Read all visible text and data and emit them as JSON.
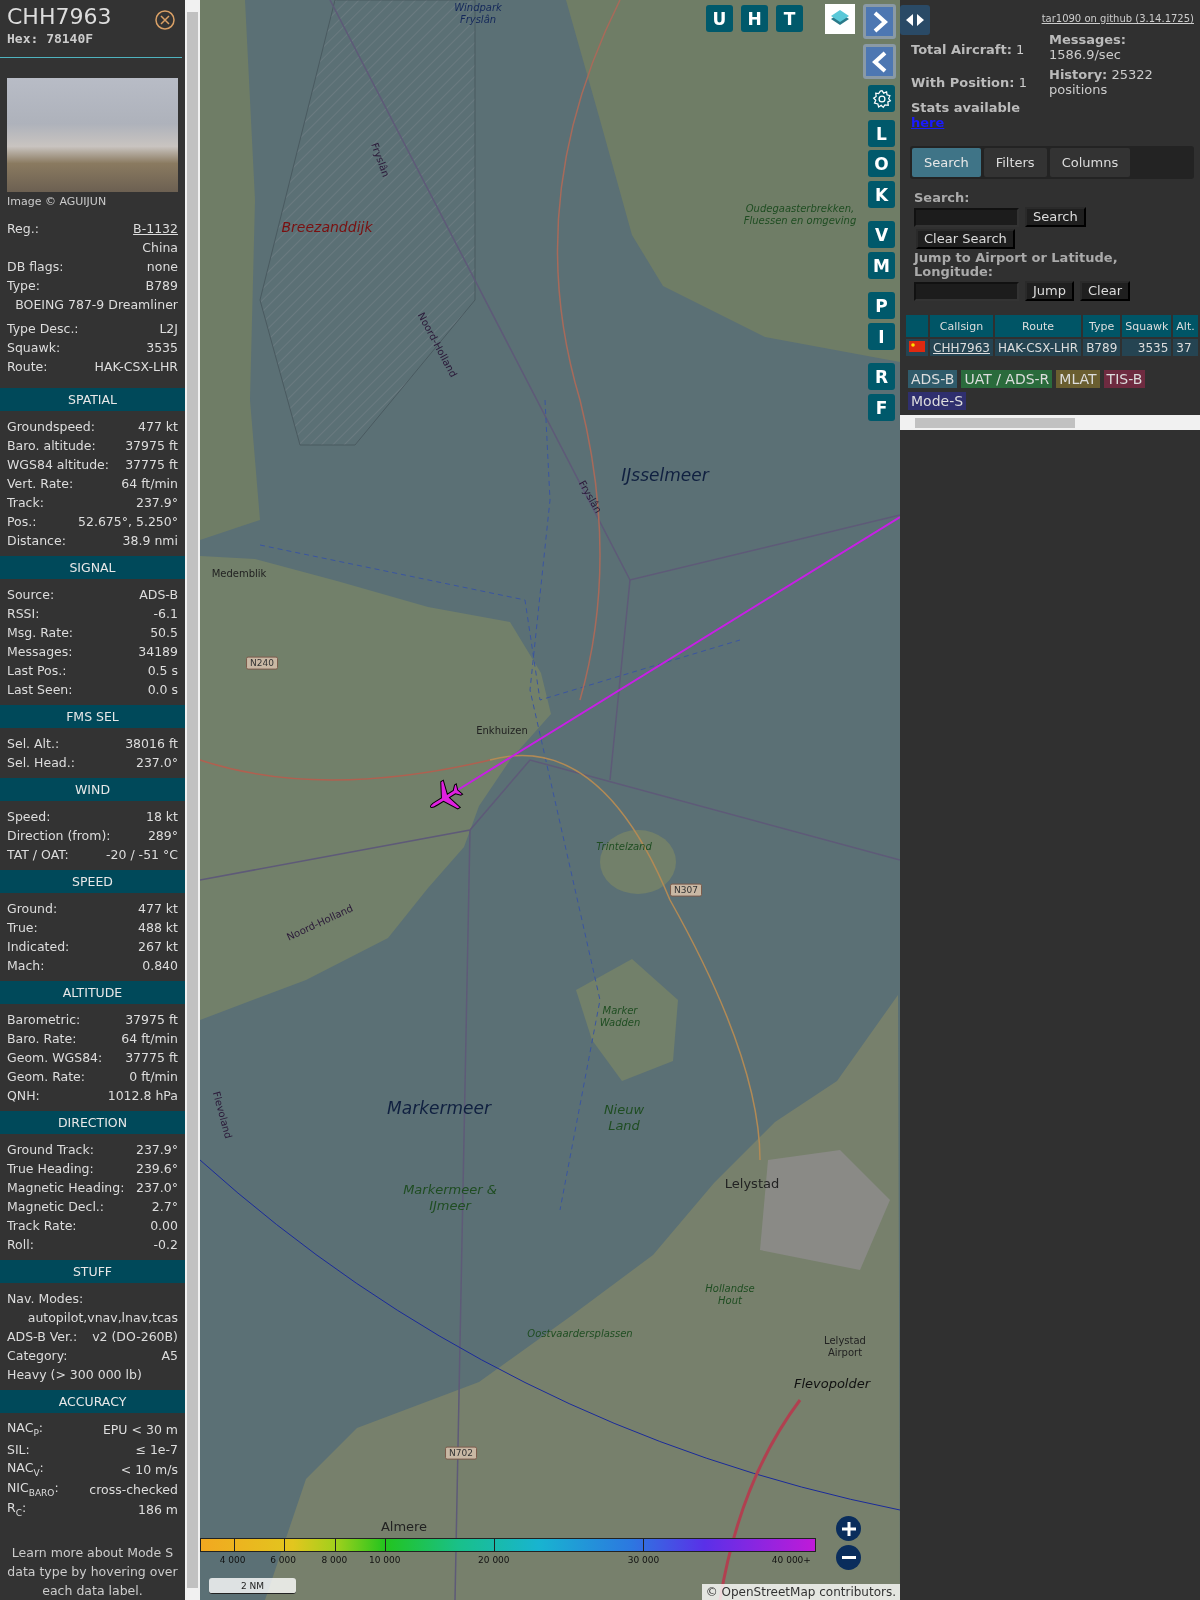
{
  "aircraft": {
    "callsign": "CHH7963",
    "hex": "Hex: 78140F",
    "photo_credit": "Image © AGUIJUN"
  },
  "details": [
    {
      "kind": "link",
      "label": "Reg.:",
      "value": "B-1132"
    },
    {
      "kind": "value",
      "value": "China"
    },
    {
      "kind": "pair",
      "label": "DB flags:",
      "value": "none"
    },
    {
      "kind": "pair",
      "label": "Type:",
      "value": "B789"
    },
    {
      "kind": "value",
      "value": "BOEING 787-9 Dreamliner"
    },
    {
      "kind": "pair",
      "label": "Type Desc.:",
      "value": "L2J"
    },
    {
      "kind": "pair",
      "label": "Squawk:",
      "value": "3535"
    },
    {
      "kind": "pair",
      "label": "Route:",
      "value": "HAK-CSX-LHR"
    }
  ],
  "sections": [
    {
      "title": "SPATIAL",
      "rows": [
        {
          "kind": "pair",
          "label": "Groundspeed:",
          "value": "477 kt"
        },
        {
          "kind": "pair",
          "label": "Baro. altitude:",
          "value": "37975 ft"
        },
        {
          "kind": "pair",
          "label": "WGS84 altitude:",
          "value": "37775 ft"
        },
        {
          "kind": "pair",
          "label": "Vert. Rate:",
          "value": "64 ft/min"
        },
        {
          "kind": "pair",
          "label": "Track:",
          "value": "237.9°"
        },
        {
          "kind": "pair",
          "label": "Pos.:",
          "value": "52.675°, 5.250°"
        },
        {
          "kind": "pair",
          "label": "Distance:",
          "value": "38.9 nmi"
        }
      ]
    },
    {
      "title": "SIGNAL",
      "rows": [
        {
          "kind": "pair",
          "label": "Source:",
          "value": "ADS-B"
        },
        {
          "kind": "pair",
          "label": "RSSI:",
          "value": "-6.1"
        },
        {
          "kind": "pair",
          "label": "Msg. Rate:",
          "value": "50.5"
        },
        {
          "kind": "pair",
          "label": "Messages:",
          "value": "34189"
        },
        {
          "kind": "pair",
          "label": "Last Pos.:",
          "value": "0.5 s"
        },
        {
          "kind": "pair",
          "label": "Last Seen:",
          "value": "0.0 s"
        }
      ]
    },
    {
      "title": "FMS SEL",
      "rows": [
        {
          "kind": "pair",
          "label": "Sel. Alt.:",
          "value": "38016 ft"
        },
        {
          "kind": "pair",
          "label": "Sel. Head.:",
          "value": "237.0°"
        }
      ]
    },
    {
      "title": "WIND",
      "rows": [
        {
          "kind": "pair",
          "label": "Speed:",
          "value": "18 kt"
        },
        {
          "kind": "pair",
          "label": "Direction (from):",
          "value": "289°"
        },
        {
          "kind": "pair",
          "label": "TAT / OAT:",
          "value": "-20 / -51 °C"
        }
      ]
    },
    {
      "title": "SPEED",
      "rows": [
        {
          "kind": "pair",
          "label": "Ground:",
          "value": "477 kt"
        },
        {
          "kind": "pair",
          "label": "True:",
          "value": "488 kt"
        },
        {
          "kind": "pair",
          "label": "Indicated:",
          "value": "267 kt"
        },
        {
          "kind": "pair",
          "label": "Mach:",
          "value": "0.840"
        }
      ]
    },
    {
      "title": "ALTITUDE",
      "rows": [
        {
          "kind": "pair",
          "label": "Barometric:",
          "value": "37975 ft"
        },
        {
          "kind": "pair",
          "label": "Baro. Rate:",
          "value": "64 ft/min"
        },
        {
          "kind": "pair",
          "label": "Geom. WGS84:",
          "value": "37775 ft"
        },
        {
          "kind": "pair",
          "label": "Geom. Rate:",
          "value": "0 ft/min"
        },
        {
          "kind": "pair",
          "label": "QNH:",
          "value": "1012.8 hPa"
        }
      ]
    },
    {
      "title": "DIRECTION",
      "rows": [
        {
          "kind": "pair",
          "label": "Ground Track:",
          "value": "237.9°"
        },
        {
          "kind": "pair",
          "label": "True Heading:",
          "value": "239.6°"
        },
        {
          "kind": "pair",
          "label": "Magnetic Heading:",
          "value": "237.0°"
        },
        {
          "kind": "pair",
          "label": "Magnetic Decl.:",
          "value": "2.7°"
        },
        {
          "kind": "pair",
          "label": "Track Rate:",
          "value": "0.00"
        },
        {
          "kind": "pair",
          "label": "Roll:",
          "value": "-0.2"
        }
      ]
    },
    {
      "title": "STUFF",
      "rows": [
        {
          "kind": "label",
          "label": "Nav. Modes:"
        },
        {
          "kind": "value",
          "value": "autopilot,vnav,lnav,tcas"
        },
        {
          "kind": "pair",
          "label": "ADS-B Ver.:",
          "value": "v2 (DO-260B)"
        },
        {
          "kind": "pair",
          "label": "Category:",
          "value": "A5"
        },
        {
          "kind": "label",
          "label": "Heavy (> 300 000 lb)"
        }
      ]
    },
    {
      "title": "ACCURACY",
      "rows": [
        {
          "kind": "pair",
          "label": "NAC$_{P}$:",
          "value": "EPU < 30 m"
        },
        {
          "kind": "pair",
          "label": "SIL:",
          "value": "≤ 1e-7"
        },
        {
          "kind": "pair",
          "label": "NAC$_{V}$:",
          "value": "< 10 m/s"
        },
        {
          "kind": "pair",
          "label": "NIC$_{BARO}$:",
          "value": "cross-checked"
        },
        {
          "kind": "pair",
          "label": "R$_{C}$:",
          "value": "186 m"
        }
      ]
    }
  ],
  "note": "Learn more about Mode S data type by hovering over each data label.",
  "map": {
    "labels": [
      {
        "kind": "water",
        "text": "Windpark Fryslân"
      },
      {
        "kind": "red",
        "text": "Breezanddijk"
      },
      {
        "kind": "nature",
        "text": "Oudegaasterbrekken, Fluessen en omgeving"
      },
      {
        "kind": "water-big",
        "text": "IJsselmeer"
      },
      {
        "kind": "place",
        "text": "Medemblik"
      },
      {
        "kind": "place",
        "text": "Enkhuizen"
      },
      {
        "kind": "road",
        "text": "N240"
      },
      {
        "kind": "nature",
        "text": "Trintelzand"
      },
      {
        "kind": "road",
        "text": "N307"
      },
      {
        "kind": "nature",
        "text": "Marker Wadden"
      },
      {
        "kind": "water-big",
        "text": "Markermeer"
      },
      {
        "kind": "nature-big",
        "text": "Nieuw Land"
      },
      {
        "kind": "nature-big",
        "text": "Markermeer & IJmeer"
      },
      {
        "kind": "town",
        "text": "Lelystad"
      },
      {
        "kind": "nature",
        "text": "Hollandse Hout"
      },
      {
        "kind": "nature",
        "text": "Oostvaardersplassen"
      },
      {
        "kind": "place",
        "text": "Lelystad Airport"
      },
      {
        "kind": "region",
        "text": "Flevopolder"
      },
      {
        "kind": "road",
        "text": "N702"
      },
      {
        "kind": "town",
        "text": "Almere"
      },
      {
        "kind": "border",
        "text": "Noord-Holland"
      },
      {
        "kind": "border",
        "text": "Fryslân"
      },
      {
        "kind": "border",
        "text": "Fryslân"
      },
      {
        "kind": "border",
        "text": "Noord-Holland"
      },
      {
        "kind": "border",
        "text": "Flevoland"
      }
    ],
    "top_buttons": [
      "U",
      "H",
      "T"
    ],
    "side_buttons": [
      "L",
      "O",
      "K",
      "V",
      "M",
      "P",
      "I",
      "R",
      "F"
    ],
    "altitude_legend": [
      "4 000",
      "6 000",
      "8 000",
      "10 000",
      "20 000",
      "30 000",
      "40 000+"
    ],
    "scale": "2 NM",
    "attribution": {
      "prefix": "©",
      "link": "OpenStreetMap",
      "suffix": "contributors."
    }
  },
  "panel": {
    "version_link": "tar1090 on github (3.14.1725)",
    "stats_left": [
      "**Total Aircraft:** 1",
      "**With Position:** 1"
    ],
    "stats_text": "Stats available",
    "stats_link": "here",
    "stats_right": [
      "**Messages:** 1586.9/sec",
      "**History:** 25322 positions"
    ],
    "tabs": [
      {
        "label": "Search",
        "selected": true
      },
      {
        "label": "Filters",
        "selected": false
      },
      {
        "label": "Columns",
        "selected": false
      }
    ],
    "search_label": "Search:",
    "search_button": "Search",
    "clear_search_button": "Clear Search",
    "jump_label": "Jump to Airport or Latitude, Longitude:",
    "jump_button": "Jump",
    "clear_button": "Clear",
    "table": {
      "columns": [
        "Callsign",
        "Route",
        "Type",
        "Squawk",
        "Alt."
      ],
      "rows": [
        {
          "callsign": "CHH7963",
          "route": "HAK-CSX-LHR",
          "type": "B789",
          "squawk": "3535",
          "alt": "37"
        }
      ]
    },
    "legend": [
      {
        "label": "ADS-B",
        "color": "#2f5b6b"
      },
      {
        "label": "UAT / ADS-R",
        "color": "#2a6b3c"
      },
      {
        "label": "MLAT",
        "color": "#6a5e30"
      },
      {
        "label": "TIS-B",
        "color": "#6e2b40"
      },
      {
        "label": "Mode-S",
        "color": "#2f2f6e"
      }
    ]
  }
}
